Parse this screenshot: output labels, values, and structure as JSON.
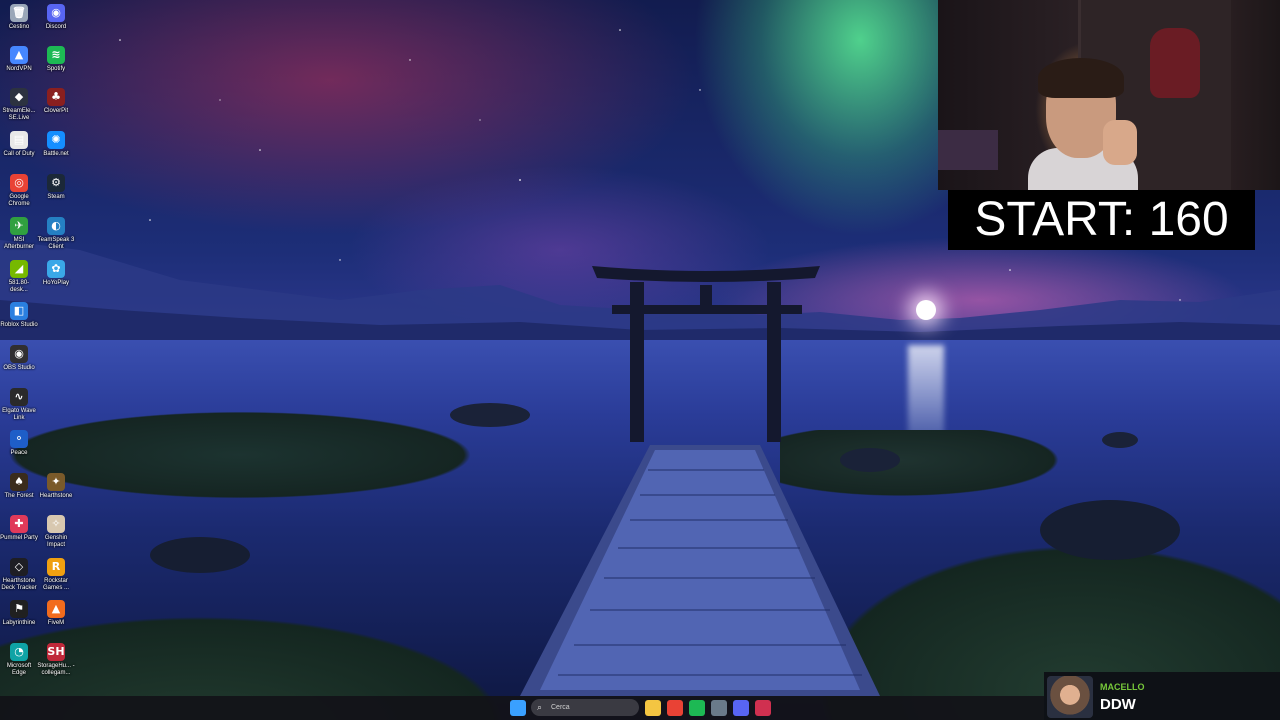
{
  "desktop": {
    "icons": [
      {
        "label": "Cestino",
        "icon": "recycle-bin-icon",
        "color": "#9aa7b8",
        "glyph": "🗑"
      },
      {
        "label": "Discord",
        "icon": "discord-icon",
        "color": "#5865f2",
        "glyph": "◉"
      },
      {
        "label": "NordVPN",
        "icon": "nordvpn-icon",
        "color": "#4687ff",
        "glyph": "▲"
      },
      {
        "label": "Spotify",
        "icon": "spotify-icon",
        "color": "#1db954",
        "glyph": "≋"
      },
      {
        "label": "StreamEle... SE.Live",
        "icon": "streamelements-icon",
        "color": "#2c3240",
        "glyph": "◆"
      },
      {
        "label": "CloverPit",
        "icon": "cloverpit-icon",
        "color": "#8a1f1f",
        "glyph": "♣"
      },
      {
        "label": "Call of Duty",
        "icon": "call-of-duty-icon",
        "color": "#e8e8e8",
        "glyph": "▤"
      },
      {
        "label": "Battle.net",
        "icon": "battlenet-icon",
        "color": "#148eff",
        "glyph": "✺"
      },
      {
        "label": "Google Chrome",
        "icon": "chrome-icon",
        "color": "#e94235",
        "glyph": "◎"
      },
      {
        "label": "Steam",
        "icon": "steam-icon",
        "color": "#1b2838",
        "glyph": "⚙"
      },
      {
        "label": "MSI Afterburner",
        "icon": "msi-afterburner-icon",
        "color": "#30a040",
        "glyph": "✈"
      },
      {
        "label": "TeamSpeak 3 Client",
        "icon": "teamspeak-icon",
        "color": "#2580c3",
        "glyph": "◐"
      },
      {
        "label": "581.80-desk...",
        "icon": "nvidia-icon",
        "color": "#76b900",
        "glyph": "◢"
      },
      {
        "label": "HoYoPlay",
        "icon": "hoyoplay-icon",
        "color": "#3aa8e8",
        "glyph": "✿"
      },
      {
        "label": "Roblox Studio",
        "icon": "roblox-studio-icon",
        "color": "#2a7fe0",
        "glyph": "◧"
      },
      {
        "label": "OBS Studio",
        "icon": "obs-icon",
        "color": "#302e31",
        "glyph": "◉"
      },
      {
        "label": "Elgato Wave Link",
        "icon": "elgato-wave-icon",
        "color": "#2a2a2a",
        "glyph": "∿"
      },
      {
        "label": "Peace",
        "icon": "peace-icon",
        "color": "#1e5ec8",
        "glyph": "⚬"
      },
      {
        "label": "The Forest",
        "icon": "the-forest-icon",
        "color": "#3a2c1c",
        "glyph": "♠"
      },
      {
        "label": "Hearthstone",
        "icon": "hearthstone-icon",
        "color": "#7a5a2a",
        "glyph": "✦"
      },
      {
        "label": "Pummel Party",
        "icon": "pummel-party-icon",
        "color": "#e03a5a",
        "glyph": "✚"
      },
      {
        "label": "Genshin Impact",
        "icon": "genshin-icon",
        "color": "#d8c8b0",
        "glyph": "✧"
      },
      {
        "label": "Hearthstone Deck Tracker",
        "icon": "deck-tracker-icon",
        "color": "#1e1e24",
        "glyph": "◇"
      },
      {
        "label": "Rockstar Games ...",
        "icon": "rockstar-icon",
        "color": "#f0a010",
        "glyph": "R"
      },
      {
        "label": "Labyrinthine",
        "icon": "labyrinthine-icon",
        "color": "#202020",
        "glyph": "⚑"
      },
      {
        "label": "FiveM",
        "icon": "fivem-icon",
        "color": "#f26b1d",
        "glyph": "▲"
      },
      {
        "label": "Microsoft Edge",
        "icon": "edge-icon",
        "color": "#0fa3a5",
        "glyph": "◔"
      },
      {
        "label": "StorageHu... - collegam...",
        "icon": "storagehub-icon",
        "color": "#c0283a",
        "glyph": "SH"
      }
    ]
  },
  "overlay": {
    "start_label": "START: 160"
  },
  "taskbar": {
    "search_placeholder": "Cerca",
    "items": [
      {
        "name": "windows-start-icon",
        "color": "#3aa0ff"
      },
      {
        "name": "file-explorer-icon",
        "color": "#f4c542"
      },
      {
        "name": "chrome-taskbar-icon",
        "color": "#e94235"
      },
      {
        "name": "spotify-taskbar-icon",
        "color": "#1db954"
      },
      {
        "name": "steam-taskbar-icon",
        "color": "#6a7a8a"
      },
      {
        "name": "discord-taskbar-icon",
        "color": "#5865f2"
      },
      {
        "name": "app-taskbar-icon",
        "color": "#d03050"
      }
    ]
  },
  "chat": {
    "username": "MACELLO",
    "message": "DDW",
    "username_color": "#77c83a"
  }
}
